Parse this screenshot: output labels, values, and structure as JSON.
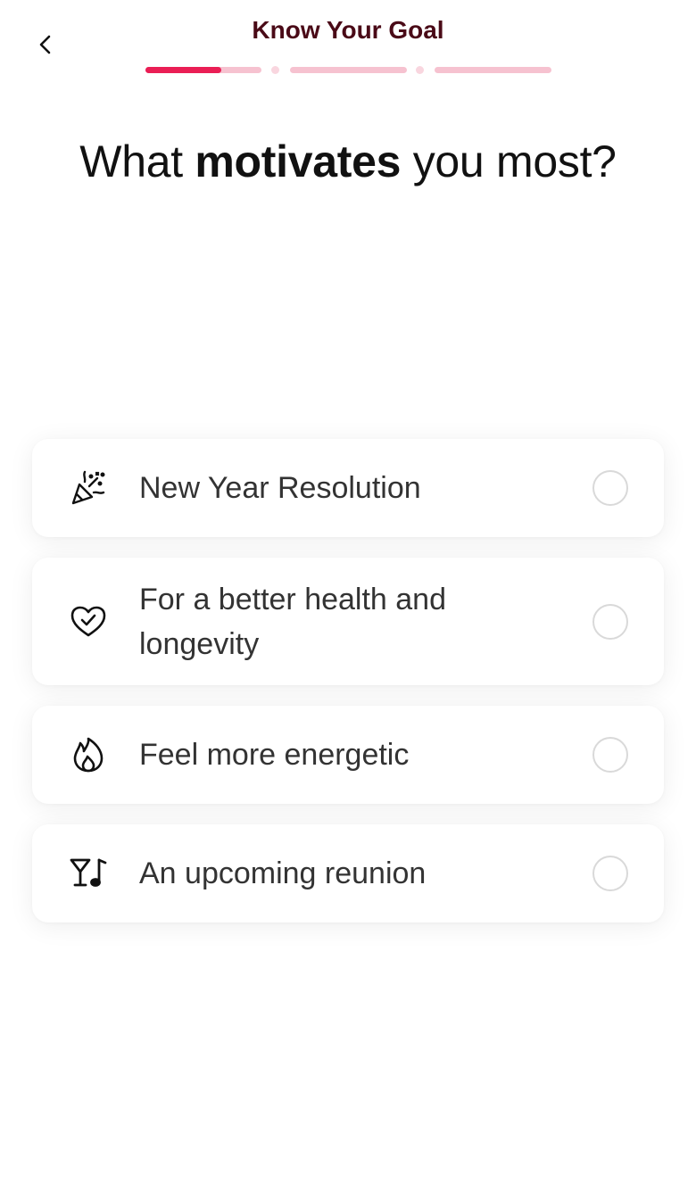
{
  "header": {
    "back_icon": "chevron-left-icon",
    "title": "Know Your Goal",
    "progress": {
      "steps": 3,
      "current_step_fill": 0.65,
      "accent": "#ea1e55",
      "track": "#f6c2d0"
    }
  },
  "question": {
    "prefix": "What",
    "emphasis": "motivates",
    "suffix": "you most?"
  },
  "options": [
    {
      "icon": "party-popper-icon",
      "label": "New Year Resolution",
      "selected": false
    },
    {
      "icon": "heart-check-icon",
      "label": "For a better health and longevity",
      "selected": false
    },
    {
      "icon": "flame-icon",
      "label": "Feel more energetic",
      "selected": false
    },
    {
      "icon": "cocktail-music-icon",
      "label": "An upcoming reunion",
      "selected": false
    }
  ]
}
